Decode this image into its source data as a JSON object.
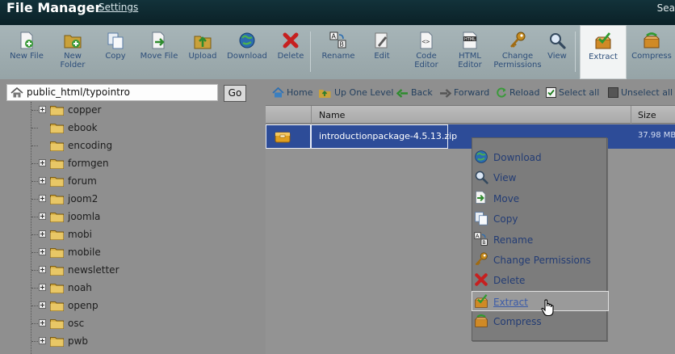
{
  "app": {
    "title": "File Manager",
    "settings_link": "Settings",
    "search_label": "Sea"
  },
  "toolbar": [
    {
      "id": "new-file",
      "lines": [
        "New File"
      ],
      "icon": "new-file-icon"
    },
    {
      "id": "new-folder",
      "lines": [
        "New",
        "Folder"
      ],
      "icon": "new-folder-icon"
    },
    {
      "id": "copy",
      "lines": [
        "Copy"
      ],
      "icon": "copy-icon"
    },
    {
      "id": "move-file",
      "lines": [
        "Move File"
      ],
      "icon": "move-file-icon"
    },
    {
      "id": "upload",
      "lines": [
        "Upload"
      ],
      "icon": "upload-icon"
    },
    {
      "id": "download",
      "lines": [
        "Download"
      ],
      "icon": "download-icon"
    },
    {
      "id": "delete",
      "lines": [
        "Delete"
      ],
      "icon": "delete-icon"
    },
    {
      "id": "rename",
      "lines": [
        "Rename"
      ],
      "icon": "rename-icon"
    },
    {
      "id": "edit",
      "lines": [
        "Edit"
      ],
      "icon": "edit-icon"
    },
    {
      "id": "code-editor",
      "lines": [
        "Code",
        "Editor"
      ],
      "icon": "code-editor-icon"
    },
    {
      "id": "html-editor",
      "lines": [
        "HTML",
        "Editor"
      ],
      "icon": "html-editor-icon"
    },
    {
      "id": "change-permissions",
      "lines": [
        "Change",
        "Permissions"
      ],
      "icon": "key-icon"
    },
    {
      "id": "view",
      "lines": [
        "View"
      ],
      "icon": "magnifier-icon"
    },
    {
      "id": "extract",
      "lines": [
        "Extract"
      ],
      "icon": "extract-icon",
      "highlighted": true
    },
    {
      "id": "compress",
      "lines": [
        "Compress"
      ],
      "icon": "compress-icon"
    }
  ],
  "path": {
    "value": "public_html/typointro",
    "go_label": "Go"
  },
  "tree": [
    "copper",
    "ebook",
    "encoding",
    "formgen",
    "forum",
    "joom2",
    "joomla",
    "mobi",
    "mobile",
    "newsletter",
    "noah",
    "openp",
    "osc",
    "pwb"
  ],
  "tree_expandable": [
    true,
    false,
    false,
    true,
    true,
    true,
    true,
    true,
    true,
    true,
    true,
    true,
    true,
    true
  ],
  "nav": {
    "home": "Home",
    "up": "Up One Level",
    "back": "Back",
    "forward": "Forward",
    "reload": "Reload",
    "select_all": "Select all",
    "unselect_all": "Unselect all"
  },
  "list": {
    "col_name": "Name",
    "col_size": "Size",
    "file": {
      "name": "introductionpackage-4.5.13.zip",
      "size": "37.98 MB"
    }
  },
  "context_menu": [
    {
      "label": "Download",
      "icon": "download-icon"
    },
    {
      "label": "View",
      "icon": "magnifier-icon"
    },
    {
      "label": "Move",
      "icon": "move-icon"
    },
    {
      "label": "Copy",
      "icon": "copy-icon"
    },
    {
      "label": "Rename",
      "icon": "rename-icon"
    },
    {
      "label": "Change Permissions",
      "icon": "key-icon"
    },
    {
      "label": "Delete",
      "icon": "delete-icon"
    },
    {
      "label": "Extract",
      "icon": "extract-icon",
      "active": true
    },
    {
      "label": "Compress",
      "icon": "compress-icon"
    }
  ],
  "colors": {
    "accent": "#2d4c98",
    "titlebar": "#12323a",
    "link": "#233c74"
  }
}
